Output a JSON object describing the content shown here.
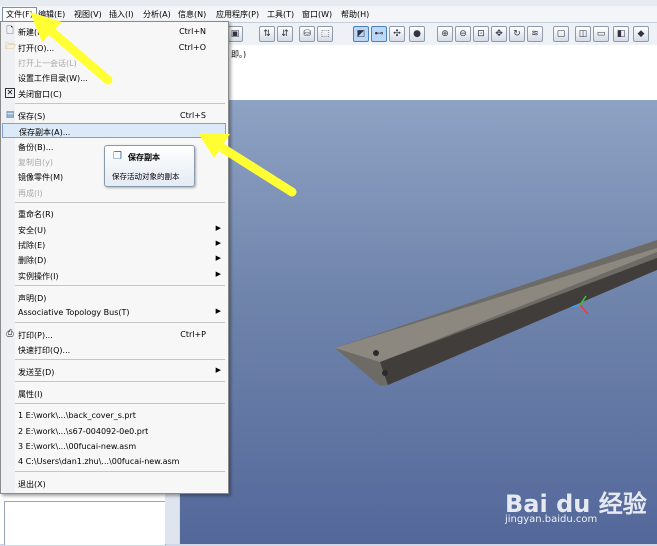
{
  "menubar": {
    "items": [
      "文件(F)",
      "编辑(E)",
      "视图(V)",
      "插入(I)",
      "分析(A)",
      "信息(N)",
      "应用程序(P)",
      "工具(T)",
      "窗口(W)",
      "帮助(H)"
    ]
  },
  "message": "即。)",
  "file_menu": [
    {
      "label": "新建(N)...",
      "shortcut": "Ctrl+N",
      "icon": "new-file-icon",
      "state": "normal"
    },
    {
      "label": "打开(O)...",
      "shortcut": "Ctrl+O",
      "icon": "open-folder-icon",
      "state": "normal"
    },
    {
      "label": "打开上一会话(L)",
      "shortcut": "",
      "icon": "",
      "state": "disabled"
    },
    {
      "label": "设置工作目录(W)...",
      "shortcut": "",
      "icon": "",
      "state": "normal"
    },
    {
      "label": "关闭窗口(C)",
      "shortcut": "",
      "icon": "close-window-icon",
      "state": "normal"
    },
    {
      "label": "保存(S)",
      "shortcut": "Ctrl+S",
      "icon": "save-icon",
      "state": "normal"
    },
    {
      "label": "保存副本(A)...",
      "shortcut": "",
      "icon": "",
      "state": "highlighted"
    },
    {
      "label": "备份(B)...",
      "shortcut": "",
      "icon": "",
      "state": "normal"
    },
    {
      "label": "复制自(y)",
      "shortcut": "",
      "icon": "",
      "state": "disabled"
    },
    {
      "label": "镜像零件(M)",
      "shortcut": "",
      "icon": "",
      "state": "normal"
    },
    {
      "label": "再成(I)",
      "shortcut": "",
      "icon": "",
      "state": "disabled"
    },
    {
      "label": "重命名(R)",
      "shortcut": "",
      "icon": "",
      "state": "normal"
    },
    {
      "label": "安全(U)",
      "shortcut": "",
      "icon": "",
      "state": "submenu"
    },
    {
      "label": "拭除(E)",
      "shortcut": "",
      "icon": "",
      "state": "submenu"
    },
    {
      "label": "删除(D)",
      "shortcut": "",
      "icon": "",
      "state": "submenu"
    },
    {
      "label": "实例操作(I)",
      "shortcut": "",
      "icon": "",
      "state": "submenu"
    },
    {
      "label": "声明(D)",
      "shortcut": "",
      "icon": "",
      "state": "normal"
    },
    {
      "label": "Associative Topology Bus(T)",
      "shortcut": "",
      "icon": "",
      "state": "submenu"
    },
    {
      "label": "打印(P)...",
      "shortcut": "Ctrl+P",
      "icon": "print-icon",
      "state": "normal"
    },
    {
      "label": "快速打印(Q)...",
      "shortcut": "",
      "icon": "",
      "state": "normal"
    },
    {
      "label": "发送至(D)",
      "shortcut": "",
      "icon": "",
      "state": "submenu"
    },
    {
      "label": "属性(I)",
      "shortcut": "",
      "icon": "",
      "state": "normal"
    },
    {
      "label": "1 E:\\work\\...\\back_cover_s.prt",
      "shortcut": "",
      "icon": "",
      "state": "normal"
    },
    {
      "label": "2 E:\\work\\...\\s67-004092-0e0.prt",
      "shortcut": "",
      "icon": "",
      "state": "normal"
    },
    {
      "label": "3 E:\\work\\...\\00fucai-new.asm",
      "shortcut": "",
      "icon": "",
      "state": "normal"
    },
    {
      "label": "4 C:\\Users\\dan1.zhu\\...\\00fucai-new.asm",
      "shortcut": "",
      "icon": "",
      "state": "normal"
    },
    {
      "label": "退出(X)",
      "shortcut": "",
      "icon": "",
      "state": "normal"
    }
  ],
  "tooltip": {
    "title": "保存副本",
    "description": "保存活动对象的副本"
  },
  "watermark": {
    "main": "Bai du 经验",
    "sub": "jingyan.baidu.com"
  },
  "colors": {
    "annotation_arrow": "#ffff33",
    "highlight": "#dce9f8"
  }
}
